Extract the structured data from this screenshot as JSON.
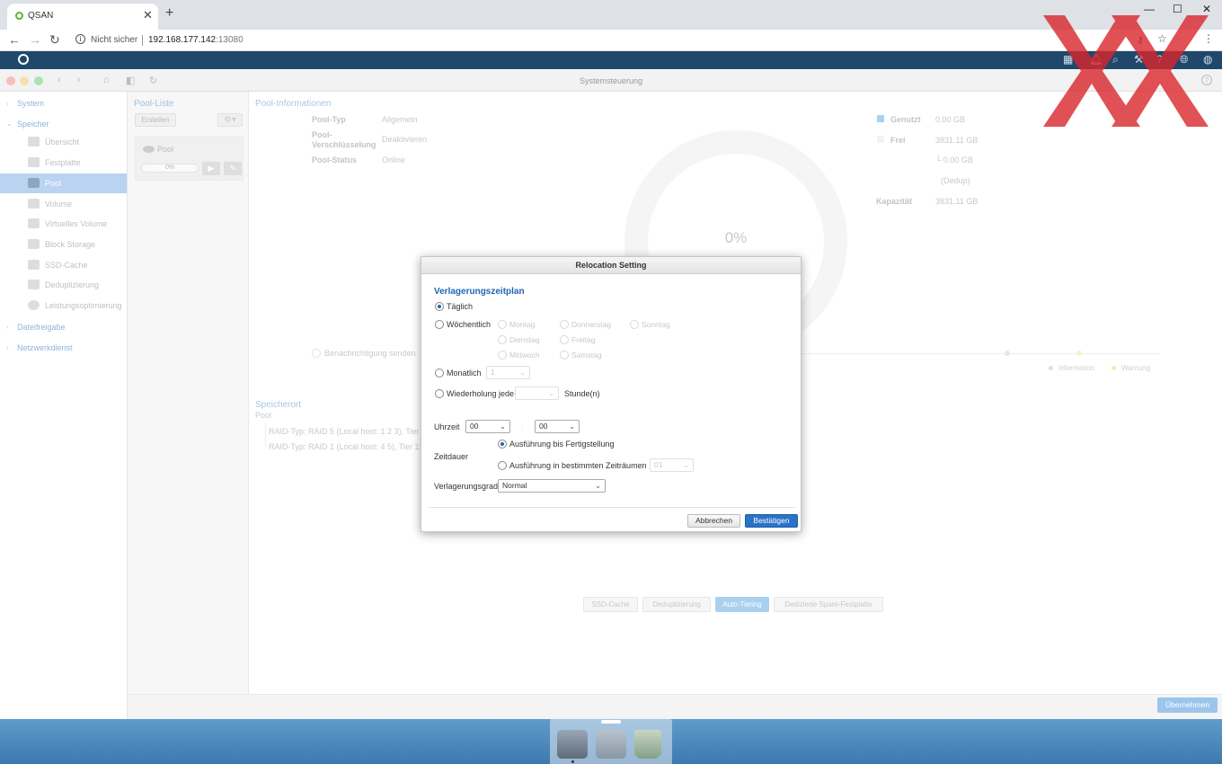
{
  "browser": {
    "tab_title": "QSAN",
    "address_security": "Nicht sicher",
    "url_host": "192.168.177.142",
    "url_port": ":13080"
  },
  "window": {
    "title": "Systemsteuerung"
  },
  "sidebar": {
    "categories": [
      "System",
      "Speicher",
      "Dateifreigabe",
      "Netzwerkdienst"
    ],
    "items": [
      {
        "label": "Übersicht",
        "icon": "overview-icon"
      },
      {
        "label": "Festplatte",
        "icon": "disk-icon"
      },
      {
        "label": "Pool",
        "icon": "pool-icon"
      },
      {
        "label": "Volume",
        "icon": "volume-icon"
      },
      {
        "label": "Virtuelles Volume",
        "icon": "virtual-volume-icon"
      },
      {
        "label": "Block Storage",
        "icon": "block-storage-icon"
      },
      {
        "label": "SSD-Cache",
        "icon": "ssd-cache-icon"
      },
      {
        "label": "Deduplizierung",
        "icon": "dedup-icon"
      },
      {
        "label": "Leistungsoptimierung",
        "icon": "performance-icon"
      }
    ],
    "active": "Pool"
  },
  "pool_list": {
    "header": "Pool-Liste",
    "create_label": "Erstellen",
    "pool_name": "Pool",
    "pool_usage": "0%"
  },
  "pool_info": {
    "header": "Pool-Informationen",
    "type_label": "Pool-Typ",
    "type_value": "Allgemein",
    "encryption_label": "Pool-Verschlüsselung",
    "encryption_value": "Deaktivieren",
    "status_label": "Pool-Status",
    "status_value": "Online",
    "usage_percent": "0%",
    "used_label": "Genutzt",
    "used_value": "0.00 GB",
    "free_label": "Frei",
    "free_value": "3831.11 GB",
    "dedup_value": "└ 0.00 GB",
    "dedup_label": "(Dedup)",
    "capacity_label": "Kapazität",
    "capacity_value": "3831.11 GB",
    "notify_label": "Benachrichtigung senden",
    "legend_info": "Information",
    "legend_warning": "Warnung",
    "location_header": "Speicherort",
    "location_pool": "Pool",
    "raid_line1": "RAID-Typ: RAID 5 (Local host: 1 2 3), Tier 3",
    "raid_line2": "RAID-Typ: RAID 1 (Local host: 4 5), Tier 1:H",
    "buttons": [
      "SSD-Cache",
      "Deduplizierung",
      "Auto-Tiering",
      "Dedizierte Spare-Festplatte"
    ],
    "apply_label": "Übernehmen",
    "used_color": "#5aa9e6",
    "warning_color": "#f5d36b"
  },
  "dialog": {
    "title": "Relocation Setting",
    "section": "Verlagerungszeitplan",
    "daily": "Täglich",
    "weekly": "Wöchentlich",
    "days": [
      "Montag",
      "Dienstag",
      "Mittwoch",
      "Donnerstag",
      "Freitag",
      "Samstag",
      "Sonntag"
    ],
    "monthly": "Monatlich",
    "monthly_value": "1",
    "repeat": "Wiederholung jede",
    "repeat_value": "",
    "hours": "Stunde(n)",
    "time_label": "Uhrzeit",
    "time_hour": "00",
    "time_sep": ":",
    "time_minute": "00",
    "duration_label": "Zeitdauer",
    "duration_complete": "Ausführung bis Fertigstellung",
    "duration_period": "Ausführung in bestimmten Zeiträumen",
    "duration_period_value": "01",
    "degree_label": "Verlagerungsgrad",
    "degree_value": "Normal",
    "cancel": "Abbrechen",
    "confirm": "Bestätigen",
    "accent": "#1f66b3"
  }
}
